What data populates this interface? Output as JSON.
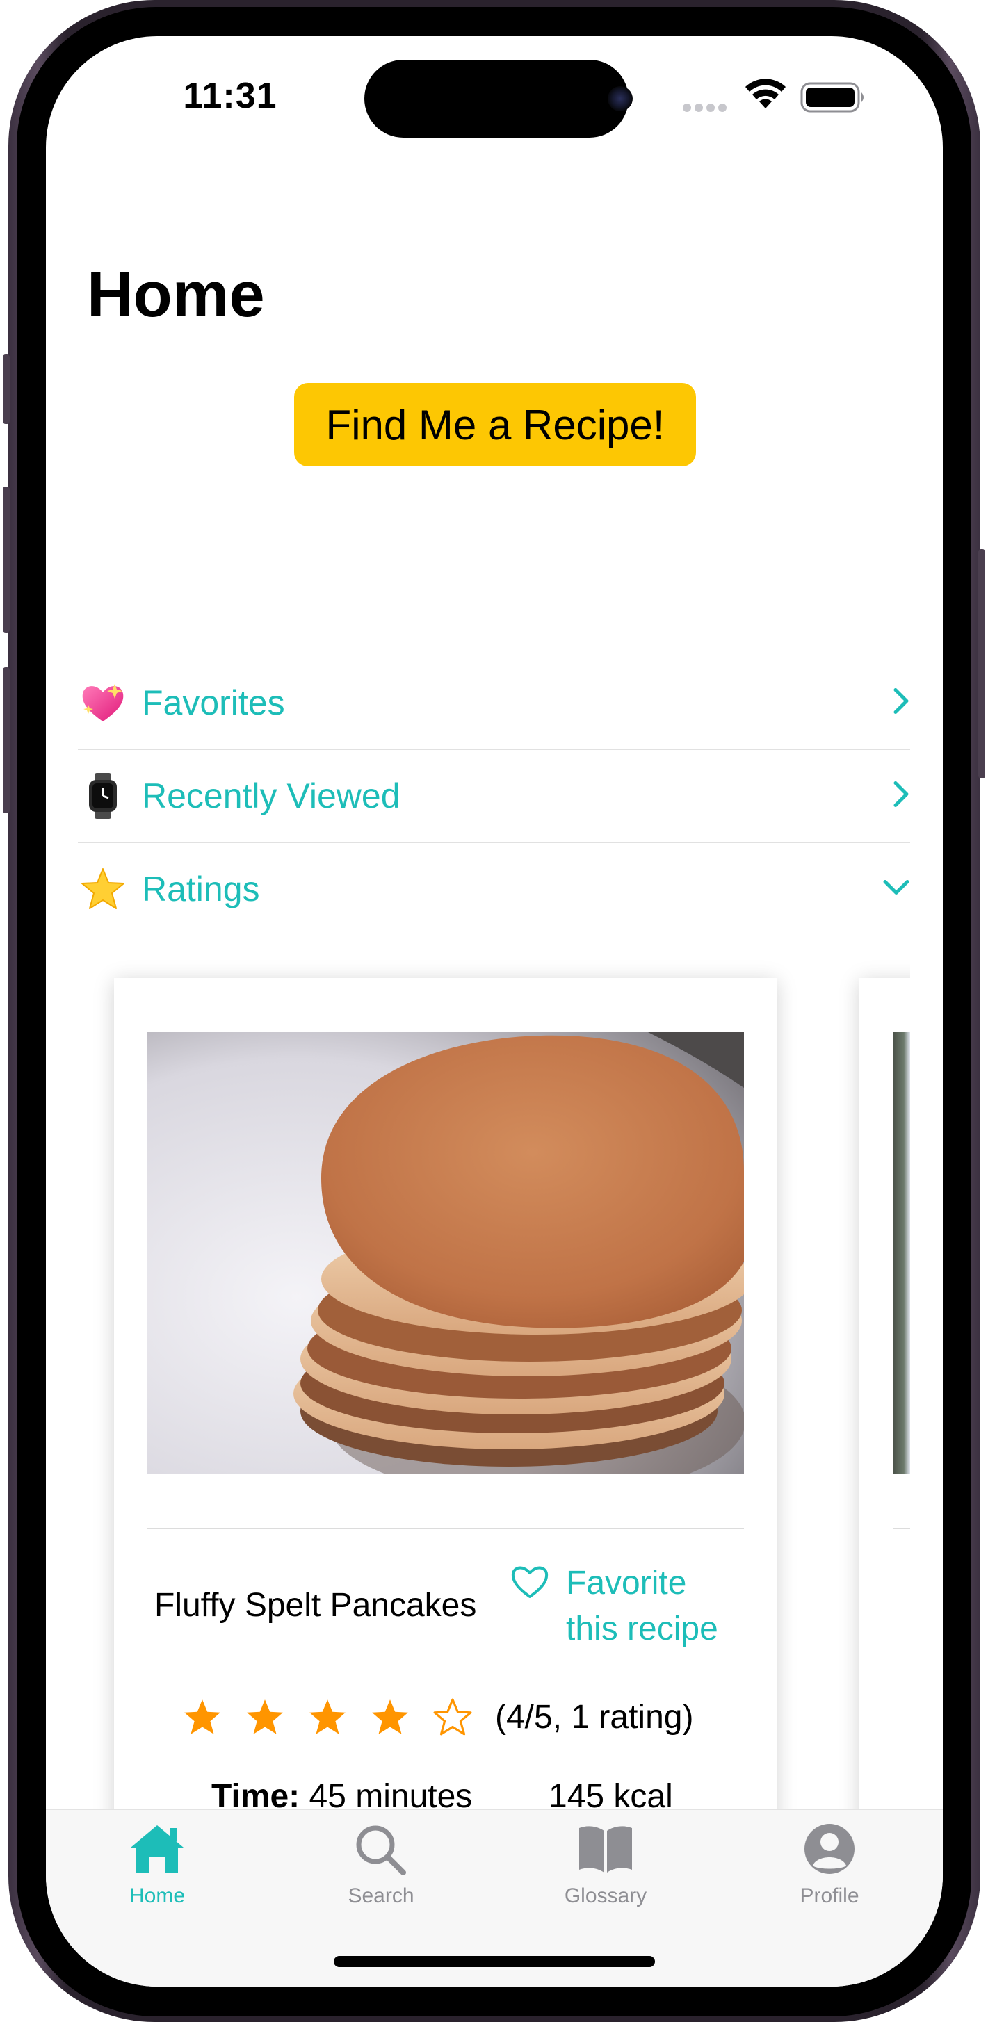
{
  "status_bar": {
    "time": "11:31"
  },
  "header": {
    "title": "Home"
  },
  "cta": {
    "label": "Find Me a Recipe!"
  },
  "sections": [
    {
      "label": "Favorites",
      "icon": "sparkling-heart-emoji",
      "chevron": "chevron-right"
    },
    {
      "label": "Recently Viewed",
      "icon": "watch-emoji",
      "chevron": "chevron-right"
    },
    {
      "label": "Ratings",
      "icon": "star-emoji",
      "chevron": "chevron-down"
    }
  ],
  "recipe_card": {
    "name": "Fluffy Spelt Pancakes",
    "favorite_label_line1": "Favorite",
    "favorite_label_line2": "this recipe",
    "rating": 4,
    "rating_max": 5,
    "rating_text": "(4/5, 1 rating)",
    "time_label": "Time:",
    "time_value": "45 minutes",
    "calories": "145 kcal"
  },
  "tab_bar": {
    "tabs": [
      {
        "label": "Home",
        "icon": "house-icon",
        "active": true
      },
      {
        "label": "Search",
        "icon": "magnifier-icon",
        "active": false
      },
      {
        "label": "Glossary",
        "icon": "book-icon",
        "active": false
      },
      {
        "label": "Profile",
        "icon": "person-circle-icon",
        "active": false
      }
    ]
  },
  "colors": {
    "accent": "#1dbdb8",
    "cta_background": "#fdc703",
    "star": "#ff9500",
    "inactive_tab": "#8e8e93"
  }
}
